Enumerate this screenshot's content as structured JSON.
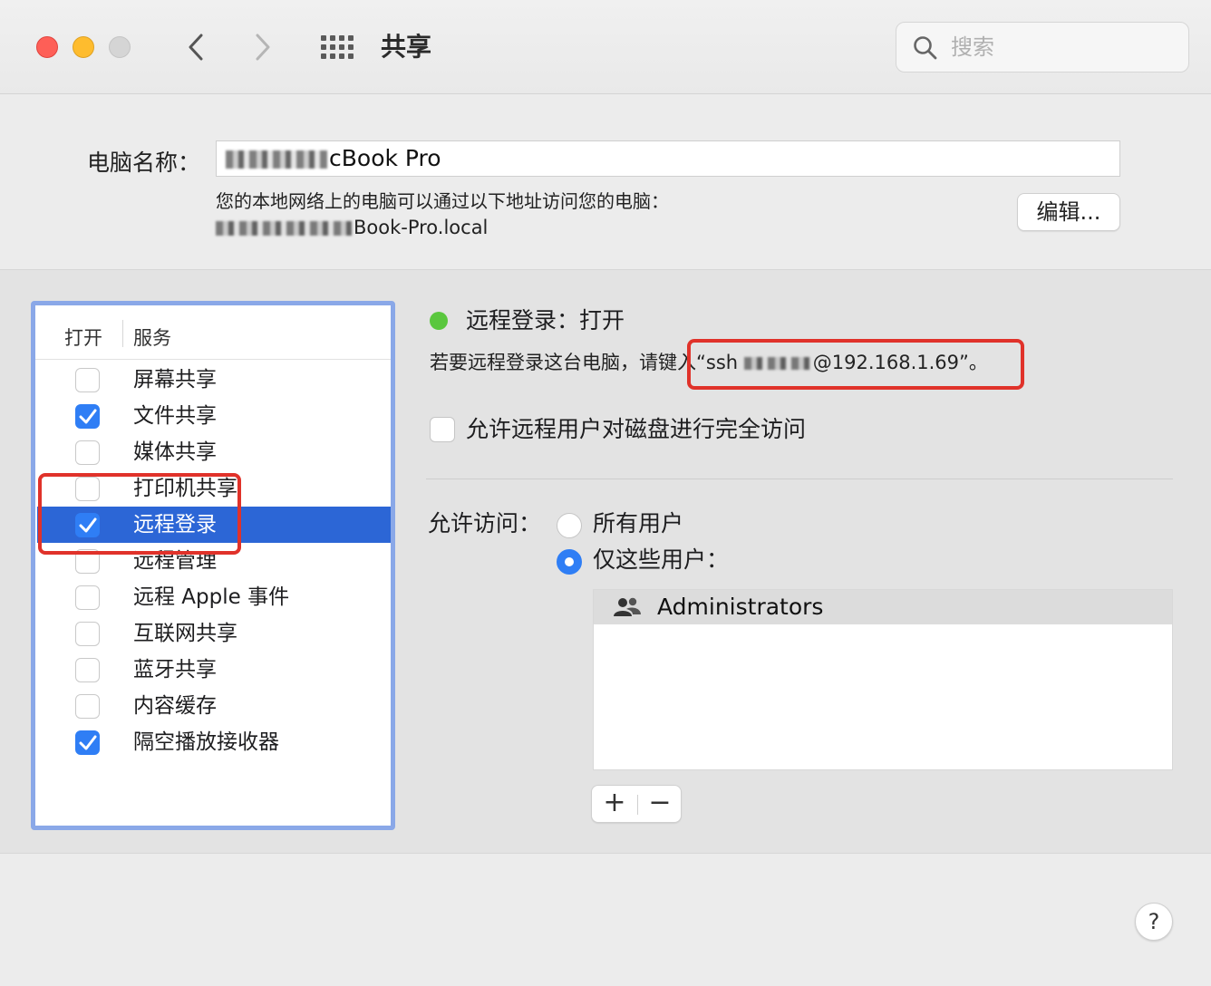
{
  "window": {
    "title": "共享",
    "search_placeholder": "搜索"
  },
  "computer_name": {
    "label": "电脑名称：",
    "value_visible_suffix": "cBook Pro",
    "local_desc": "您的本地网络上的电脑可以通过以下地址访问您的电脑：",
    "local_address_visible_suffix": "Book-Pro.local",
    "edit_label": "编辑..."
  },
  "services": {
    "header_open": "打开",
    "header_service": "服务",
    "items": [
      {
        "label": "屏幕共享",
        "checked": false,
        "selected": false
      },
      {
        "label": "文件共享",
        "checked": true,
        "selected": false
      },
      {
        "label": "媒体共享",
        "checked": false,
        "selected": false
      },
      {
        "label": "打印机共享",
        "checked": false,
        "selected": false
      },
      {
        "label": "远程登录",
        "checked": true,
        "selected": true
      },
      {
        "label": "远程管理",
        "checked": false,
        "selected": false
      },
      {
        "label": "远程 Apple 事件",
        "checked": false,
        "selected": false
      },
      {
        "label": "互联网共享",
        "checked": false,
        "selected": false
      },
      {
        "label": "蓝牙共享",
        "checked": false,
        "selected": false
      },
      {
        "label": "内容缓存",
        "checked": false,
        "selected": false
      },
      {
        "label": "隔空播放接收器",
        "checked": true,
        "selected": false
      }
    ]
  },
  "detail": {
    "status": "远程登录：打开",
    "status_color": "#5ac73e",
    "instruction_prefix": "若要远程登录这台电脑，请键入“ssh ",
    "instruction_suffix": "@192.168.1.69”。",
    "full_access_label": "允许远程用户对磁盘进行完全访问",
    "full_access_checked": false,
    "allow_access_label": "允许访问：",
    "radio_all": "所有用户",
    "radio_only": "仅这些用户：",
    "selected_radio": "only",
    "users": [
      "Administrators"
    ],
    "add_label": "+",
    "remove_label": "−"
  },
  "help_label": "?",
  "colors": {
    "accent": "#2f7ef5",
    "selection": "#2c66d6",
    "highlight_annotation": "#e0322a"
  }
}
